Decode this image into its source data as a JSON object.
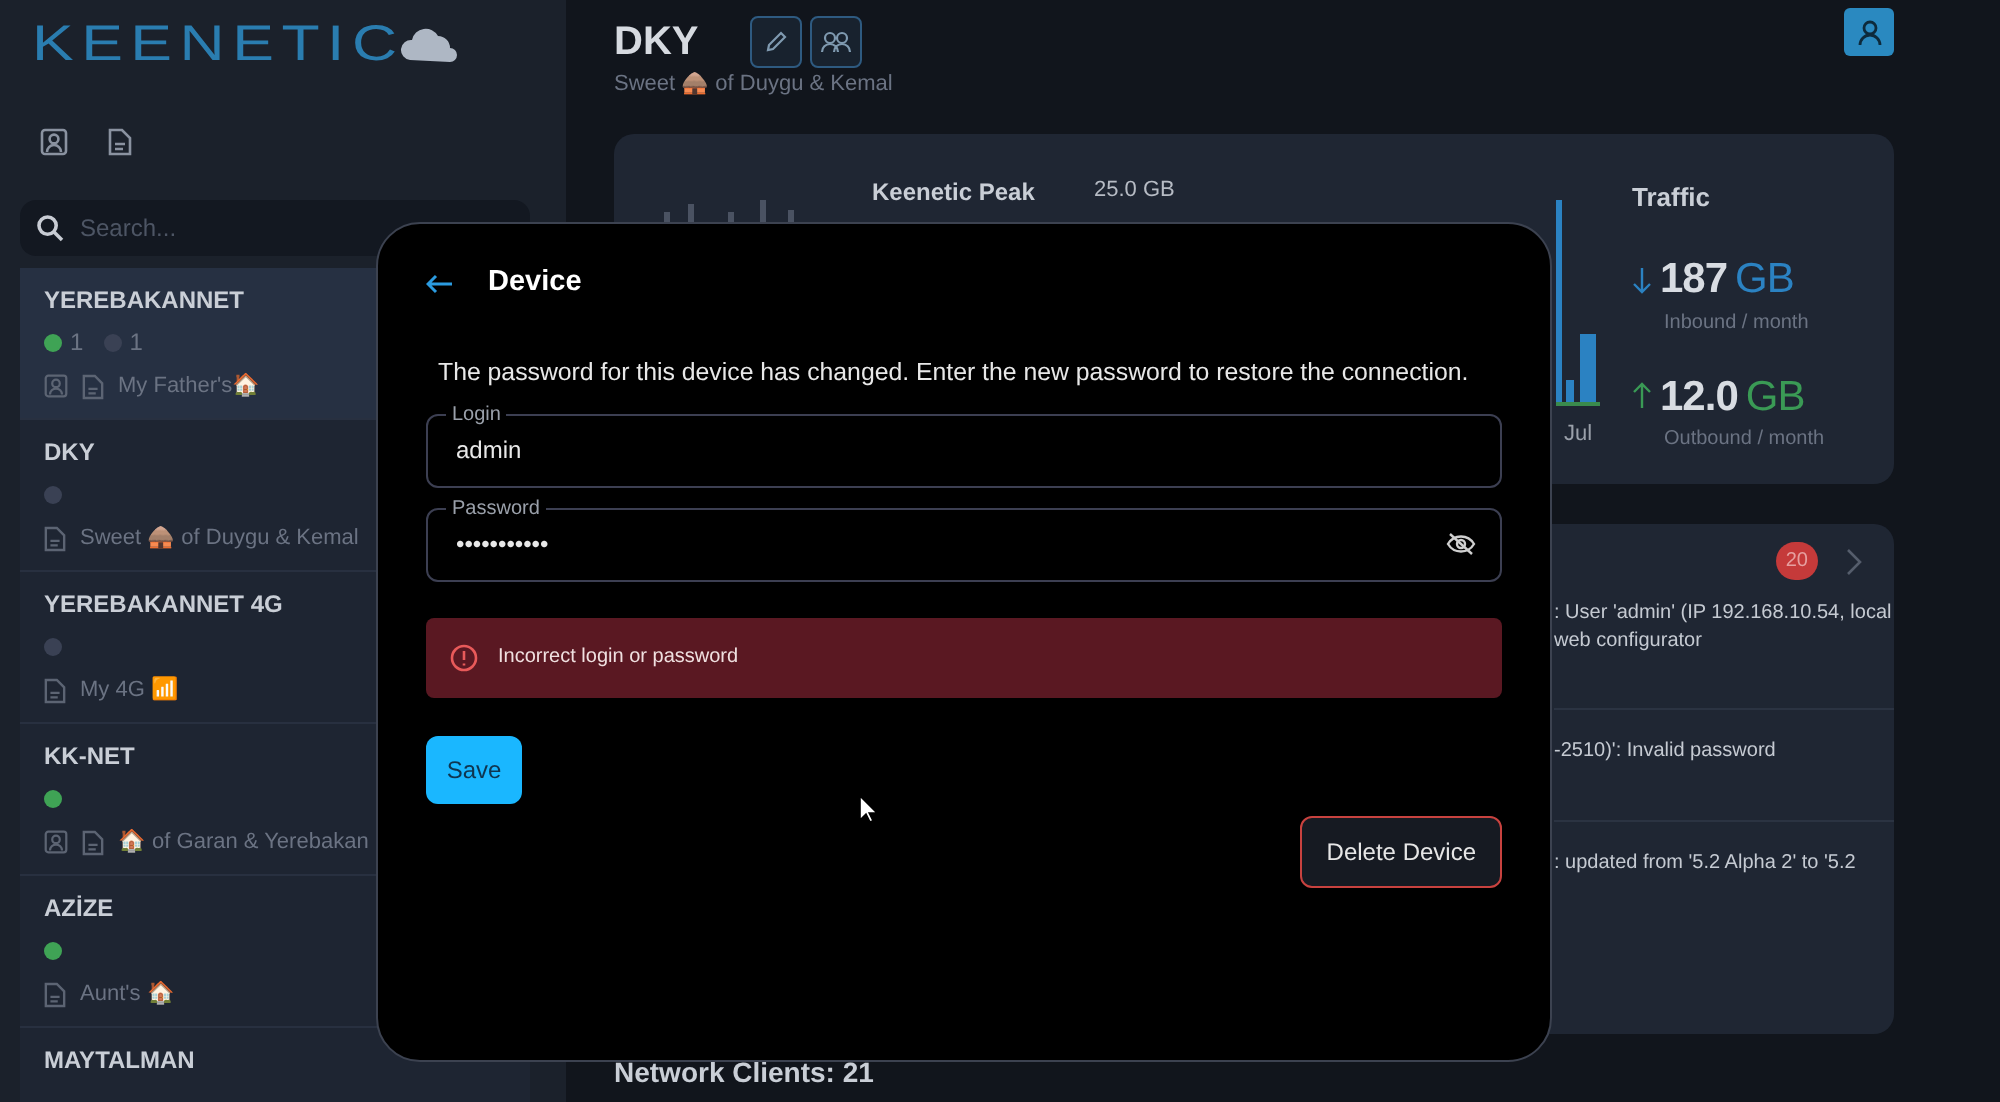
{
  "sidebar": {
    "logo": "KEENETIC",
    "search": {
      "placeholder": "Search..."
    },
    "items": [
      {
        "name": "YEREBAKANNET",
        "selected": true,
        "dots": [
          {
            "color": "#3fa355",
            "count": "1"
          },
          {
            "color": "#3a4154",
            "count": "1"
          }
        ],
        "contact_icon": true,
        "description": "My Father's🏠"
      },
      {
        "name": "DKY",
        "selected": false,
        "dots": [
          {
            "color": "#3a4154"
          }
        ],
        "contact_icon": false,
        "description": "Sweet 🛖 of Duygu & Kemal"
      },
      {
        "name": "YEREBAKANNET 4G",
        "selected": false,
        "dots": [
          {
            "color": "#3a4154"
          }
        ],
        "contact_icon": false,
        "description": "My 4G 📶"
      },
      {
        "name": "KK-NET",
        "selected": false,
        "dots": [
          {
            "color": "#3fa355"
          }
        ],
        "contact_icon": true,
        "description": "🏠 of Garan & Yerebakan"
      },
      {
        "name": "AZİZE",
        "selected": false,
        "dots": [
          {
            "color": "#3fa355"
          }
        ],
        "contact_icon": false,
        "description": "Aunt's 🏠"
      },
      {
        "name": "MAYTALMAN",
        "selected": false
      }
    ]
  },
  "header": {
    "title": "DKY",
    "subtitle": "Sweet 🛖 of Duygu & Kemal"
  },
  "device_card": {
    "model": "Keenetic Peak",
    "usage": "25.0 GB",
    "chart_label": "Jul",
    "traffic": {
      "title": "Traffic",
      "inbound": {
        "value": "187",
        "unit": "GB",
        "caption": "Inbound / month"
      },
      "outbound": {
        "value": "12.0",
        "unit": "GB",
        "caption": "Outbound / month"
      }
    }
  },
  "events": {
    "badge": "20",
    "rows": [
      {
        "lines": [
          ": User 'admin' (IP 192.168.10.54, local",
          "web configurator"
        ]
      },
      {
        "lines": [
          "-2510)': Invalid password"
        ]
      },
      {
        "lines": [
          ": updated from '5.2 Alpha 2' to '5.2"
        ]
      }
    ]
  },
  "section_title": "Network Clients: 21",
  "dialog": {
    "title": "Device",
    "message": "The password for this device has changed. Enter the new password to restore the connection.",
    "fields": [
      {
        "kind": "text",
        "label": "Login",
        "value": "admin"
      },
      {
        "kind": "password",
        "label": "Password",
        "value": "•••••••••••"
      }
    ],
    "error": "Incorrect login or password",
    "save": "Save",
    "delete": "Delete Device"
  }
}
